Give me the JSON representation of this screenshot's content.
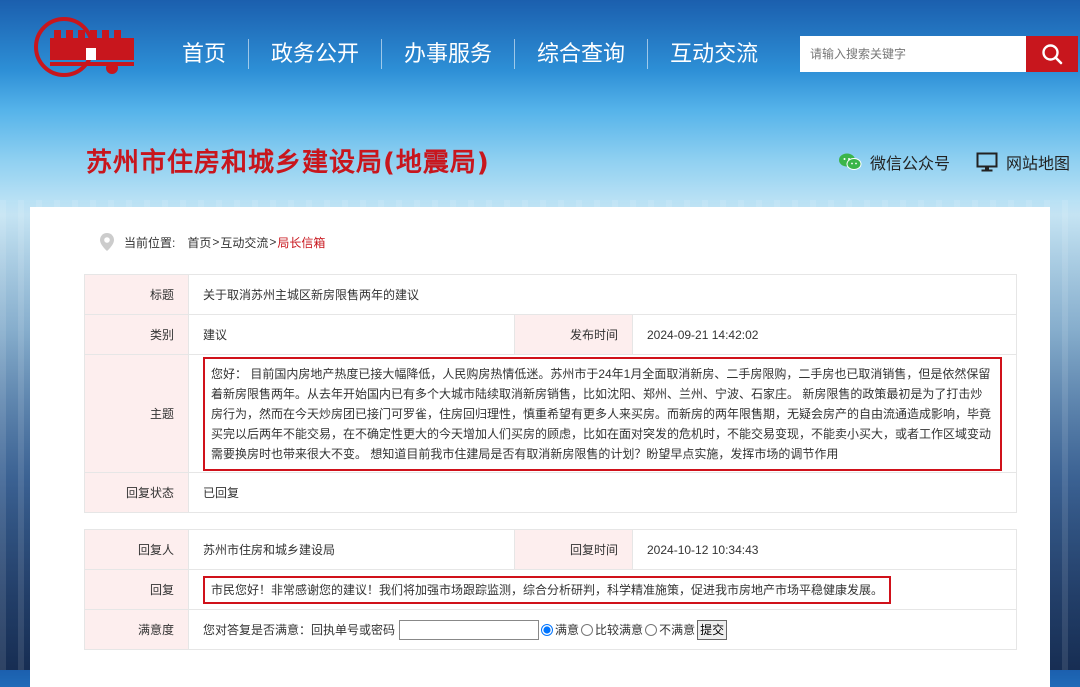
{
  "nav": {
    "items": [
      "首页",
      "政务公开",
      "办事服务",
      "综合查询",
      "互动交流"
    ]
  },
  "search": {
    "placeholder": "请输入搜索关键字"
  },
  "header": {
    "title": "苏州市住房和城乡建设局(地震局)",
    "wechat": "微信公众号",
    "sitemap": "网站地图"
  },
  "breadcrumb": {
    "label": "当前位置:",
    "home": "首页",
    "sep": ">",
    "section": "互动交流",
    "current": "局长信箱"
  },
  "letter": {
    "title_label": "标题",
    "title": "关于取消苏州主城区新房限售两年的建议",
    "category_label": "类别",
    "category": "建议",
    "date_label": "发布时间",
    "date": "2024-09-21 14:42:02",
    "subject_label": "主题",
    "subject": "您好： 目前国内房地产热度已接大幅降低，人民购房热情低迷。苏州市于24年1月全面取消新房、二手房限购，二手房也已取消销售，但是依然保留着新房限售两年。从去年开始国内已有多个大城市陆续取消新房销售，比如沈阳、郑州、兰州、宁波、石家庄。 新房限售的政策最初是为了打击炒房行为，然而在今天炒房团已接门可罗雀，住房回归理性，慎重希望有更多人来买房。而新房的两年限售期，无疑会房产的自由流通造成影响，毕竟买完以后两年不能交易，在不确定性更大的今天增加人们买房的顾虑，比如在面对突发的危机时，不能交易变现，不能卖小买大，或者工作区域变动需要换房时也带来很大不变。 想知道目前我市住建局是否有取消新房限售的计划？盼望早点实施，发挥市场的调节作用",
    "status_label": "回复状态",
    "status": "已回复"
  },
  "reply": {
    "replier_label": "回复人",
    "replier": "苏州市住房和城乡建设局",
    "time_label": "回复时间",
    "time": "2024-10-12 10:34:43",
    "content_label": "回复",
    "content": "市民您好！非常感谢您的建议！我们将加强市场跟踪监测，综合分析研判，科学精准施策，促进我市房地产市场平稳健康发展。",
    "satisfaction_label": "满意度",
    "question": "您对答复是否满意：",
    "receipt_label": "回执单号或密码",
    "options": [
      "满意",
      "比较满意",
      "不满意"
    ],
    "selected": "满意",
    "submit": "提交"
  },
  "colors": {
    "brand_red": "#c8161d",
    "label_bg": "#fdeeee",
    "wechat_green": "#3bb54a"
  }
}
